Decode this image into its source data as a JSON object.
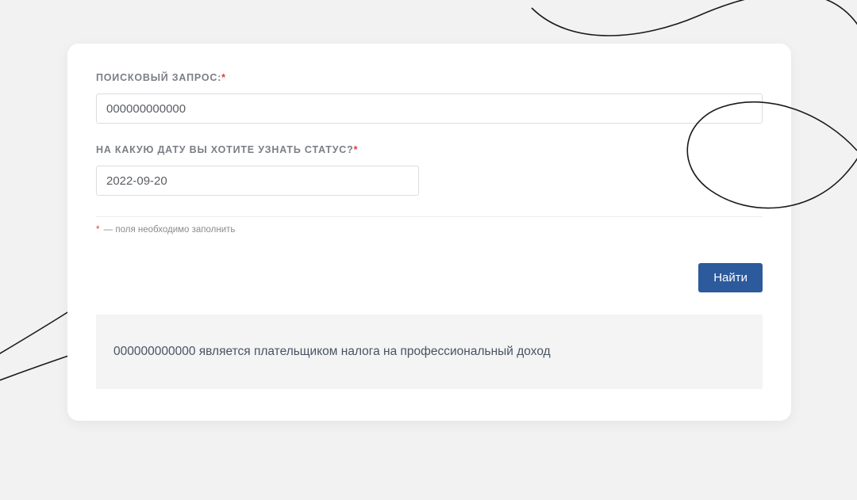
{
  "form": {
    "searchLabel": "ПОИСКОВЫЙ ЗАПРОС:",
    "searchValue": "000000000000",
    "dateLabel": "НА КАКУЮ ДАТУ ВЫ ХОТИТЕ УЗНАТЬ СТАТУС?",
    "dateValue": "2022-09-20",
    "requiredMark": "*",
    "footnote": " — поля необходимо заполнить",
    "submitLabel": "Найти"
  },
  "result": {
    "message": "000000000000 является плательщиком налога на профессиональный доход"
  }
}
